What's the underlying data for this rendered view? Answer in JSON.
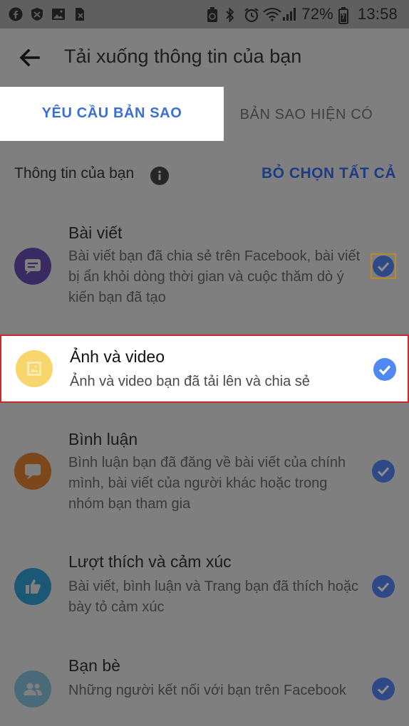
{
  "status_bar": {
    "battery_percent": "72%",
    "time": "13:58",
    "left_icons": [
      "facebook-icon",
      "shield-app-icon",
      "gallery-icon",
      "no-sim-icon"
    ],
    "right_icons": [
      "battery-saver-icon",
      "bluetooth-icon",
      "alarm-icon",
      "wifi-icon",
      "signal-icon",
      "battery-icon"
    ]
  },
  "header": {
    "title": "Tải xuống thông tin của bạn",
    "back_icon": "arrow-left-icon"
  },
  "tabs": [
    {
      "label": "YÊU CẦU BẢN SAO",
      "selected": true
    },
    {
      "label": "BẢN SAO HIỆN CÓ",
      "selected": false
    }
  ],
  "info_bar": {
    "label": "Thông tin của bạn",
    "info_icon": "info-icon",
    "deselect_all": "BỎ CHỌN TẤT CẢ"
  },
  "categories": [
    {
      "title": "Bài viết",
      "description": "Bài viết bạn đã chia sẻ trên Facebook, bài viết bị ẩn khỏi dòng thời gian và cuộc thăm dò ý kiến bạn đã tạo",
      "icon": "message-icon",
      "color": "#3a2a62",
      "checked": true
    },
    {
      "title": "Ảnh và video",
      "description": "Ảnh và video bạn đã tải lên và chia sẻ",
      "icon": "photo-icon",
      "color": "#f7d66e",
      "checked": true,
      "highlighted": true
    },
    {
      "title": "Bình luận",
      "description": "Bình luận bạn đã đăng về bài viết của chính mình, bài viết của người khác hoặc trong nhóm bạn tham gia",
      "icon": "comment-icon",
      "color": "#7c471a",
      "checked": true
    },
    {
      "title": "Lượt thích và cảm xúc",
      "description": "Bài viết, bình luận và Trang bạn đã thích hoặc bày tỏ cảm xúc",
      "icon": "thumbs-up-icon",
      "color": "#1b5876",
      "checked": true
    },
    {
      "title": "Bạn bè",
      "description": "Những người kết nối với bạn trên Facebook",
      "icon": "friends-icon",
      "color": "#4a6a7a",
      "checked": true
    }
  ],
  "colors": {
    "accent": "#3b6fd6",
    "check_active": "#4f88f3",
    "highlight_border": "#d0262b",
    "overlay_gray": "#7f7f7f"
  }
}
